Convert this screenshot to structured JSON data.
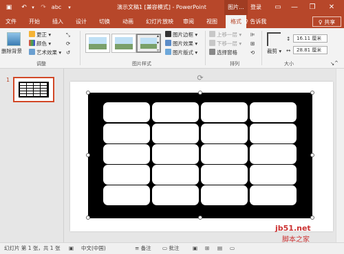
{
  "titlebar": {
    "title": "演示文稿1 [兼容模式] - PowerPoint",
    "context_tab": "图片...",
    "login": "登录",
    "minimize": "—",
    "restore": "❐",
    "close": "✕"
  },
  "tabs": [
    "文件",
    "开始",
    "插入",
    "设计",
    "切换",
    "动画",
    "幻灯片放映",
    "审阅",
    "视图",
    "格式"
  ],
  "active_tab": "格式",
  "tell_me": "♀ 告诉我",
  "share": "♀ 共享",
  "ribbon": {
    "remove_bg": "删除背景",
    "corrections": "更正",
    "color": "颜色",
    "artistic": "艺术效果",
    "adjust_label": "调整",
    "styles_label": "图片样式",
    "border": "图片边框",
    "effects": "图片效果",
    "layout": "图片版式",
    "bring_forward": "上移一层",
    "send_backward": "下移一层",
    "selection_pane": "选择窗格",
    "arrange_label": "排列",
    "crop": "裁剪",
    "height": "16.11 厘米",
    "width": "28.81 厘米",
    "size_label": "大小"
  },
  "thumbnail": {
    "slide_number": "1"
  },
  "status": {
    "slide_info": "幻灯片 第 1 张，共 1 张",
    "language": "中文(中国)",
    "notes": "备注",
    "comments": "批注"
  },
  "watermark": {
    "line1": "jb51.net",
    "line2": "脚本之家"
  },
  "colors": {
    "accent": "#b7472a",
    "thumb_border": "#d24726"
  }
}
